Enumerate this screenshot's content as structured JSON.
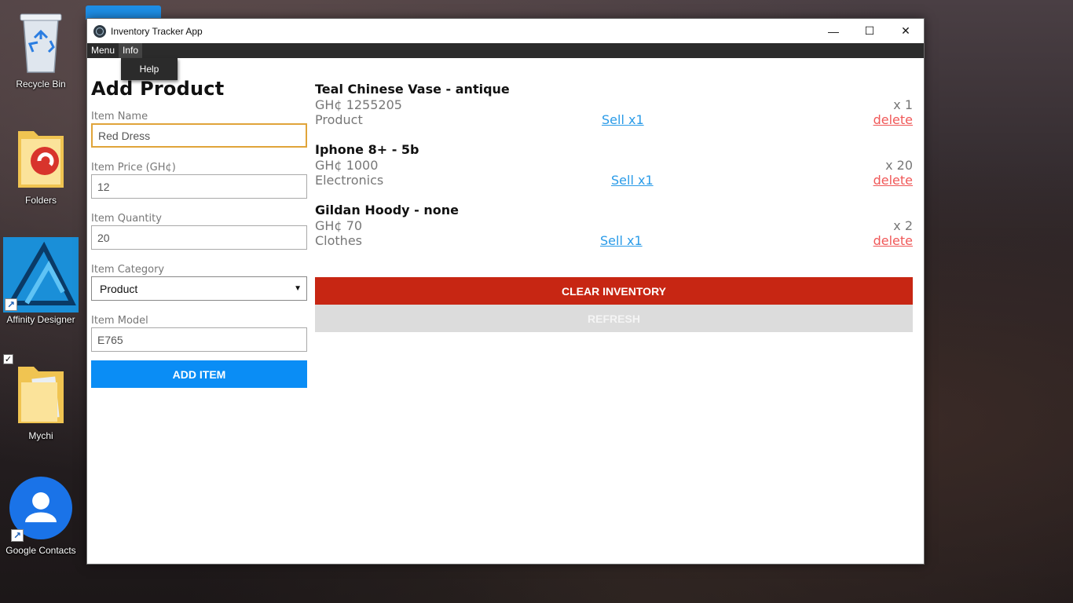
{
  "desktop": {
    "icons": [
      {
        "label": "Recycle Bin"
      },
      {
        "label": "Folders"
      },
      {
        "label": "Affinity Designer"
      },
      {
        "label": "Mychi"
      },
      {
        "label": "Google Contacts"
      }
    ]
  },
  "window": {
    "title": "Inventory Tracker App",
    "controls": {
      "minimize": "—",
      "maximize": "☐",
      "close": "✕"
    }
  },
  "menubar": {
    "items": [
      {
        "label": "Menu"
      },
      {
        "label": "Info"
      }
    ],
    "open_dropdown": {
      "items": [
        {
          "label": "Help"
        }
      ]
    }
  },
  "form": {
    "heading": "Add Product",
    "item_name": {
      "label": "Item Name",
      "value": "Red Dress"
    },
    "item_price": {
      "label": "Item Price (GH¢)",
      "value": "12"
    },
    "item_quantity": {
      "label": "Item Quantity",
      "value": "20"
    },
    "item_category": {
      "label": "Item Category",
      "value": "Product"
    },
    "item_model": {
      "label": "Item Model",
      "value": "E765"
    },
    "add_button": "ADD ITEM"
  },
  "inventory": {
    "items": [
      {
        "name": "Teal Chinese Vase - antique",
        "price": "GH¢ 1255205",
        "category": "Product",
        "quantity": "x 1",
        "sell": "Sell x1",
        "delete": "delete"
      },
      {
        "name": "Iphone 8+ - 5b",
        "price": "GH¢ 1000",
        "category": "Electronics",
        "quantity": "x 20",
        "sell": "Sell x1",
        "delete": "delete"
      },
      {
        "name": "Gildan Hoody - none",
        "price": "GH¢ 70",
        "category": "Clothes",
        "quantity": "x 2",
        "sell": "Sell x1",
        "delete": "delete"
      }
    ],
    "clear_button": "CLEAR INVENTORY",
    "refresh_button": "REFRESH"
  },
  "colors": {
    "add_button": "#0a8df5",
    "clear_button": "#c72613",
    "refresh_button": "#dcdcdc",
    "sell_link": "#2a9be8",
    "delete_link": "#f05858",
    "focus_border": "#e0a43a",
    "menubar": "#2b2b2b"
  }
}
